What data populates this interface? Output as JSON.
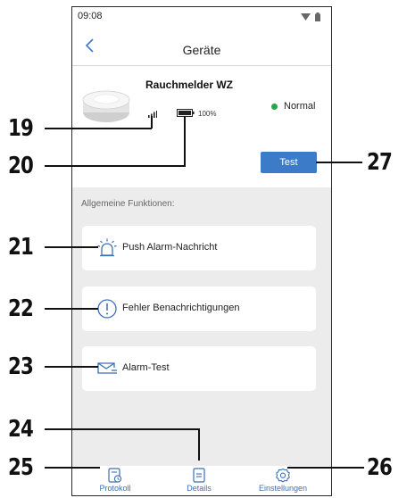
{
  "status_bar": {
    "time": "09:08"
  },
  "header": {
    "title": "Geräte"
  },
  "device": {
    "name": "Rauchmelder WZ",
    "battery": "100%",
    "status": "Normal",
    "status_color": "#2ca24a"
  },
  "test_button": {
    "label": "Test",
    "color": "#3b7bc8"
  },
  "functions": {
    "section_label": "Allgemeine Funktionen:",
    "items": [
      {
        "label": "Push Alarm-Nachricht",
        "icon": "alarm-light-icon"
      },
      {
        "label": "Fehler Benachrichtigungen",
        "icon": "exclamation-circle-icon"
      },
      {
        "label": "Alarm-Test",
        "icon": "envelope-icon"
      }
    ]
  },
  "tabbar": {
    "items": [
      {
        "label": "Protokoll",
        "icon": "log-icon"
      },
      {
        "label": "Details",
        "icon": "document-icon"
      },
      {
        "label": "Einstellungen",
        "icon": "gear-icon"
      }
    ],
    "accent": "#3b6fb8"
  },
  "callouts": [
    "19",
    "20",
    "21",
    "22",
    "23",
    "24",
    "25",
    "26",
    "27"
  ]
}
